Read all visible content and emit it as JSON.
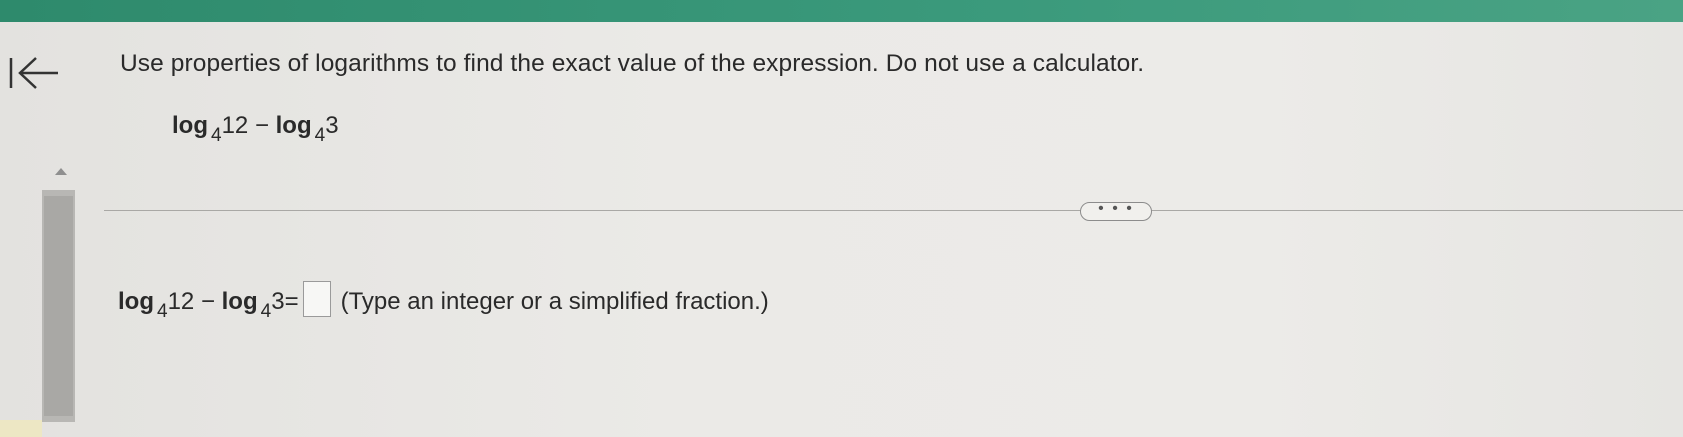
{
  "icons": {
    "back": "back-to-start-icon",
    "scroll_up": "triangle-up-icon",
    "more": "ellipsis-icon"
  },
  "colors": {
    "top_bar": "#3b9a7c",
    "background": "#ebeae7",
    "divider": "#a9a8a5"
  },
  "question": {
    "instruction": "Use properties of logarithms to find the exact value of the expression. Do not use a calculator.",
    "expression": {
      "log1": "log",
      "base1": "4",
      "arg1": "12",
      "operator": "−",
      "log2": "log",
      "base2": "4",
      "arg2": "3"
    }
  },
  "more_button": {
    "label": "• • •"
  },
  "answer": {
    "expression": {
      "log1": "log",
      "base1": "4",
      "arg1": "12",
      "operator": "−",
      "log2": "log",
      "base2": "4",
      "arg2": "3",
      "equals": "="
    },
    "input_value": "",
    "hint": "(Type an integer or a simplified fraction.)"
  }
}
